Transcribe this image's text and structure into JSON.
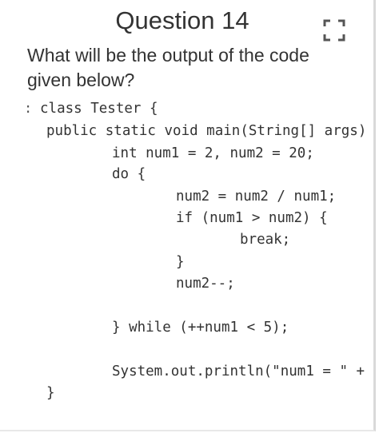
{
  "header": {
    "title": "Question 14",
    "expand_icon": "fullscreen-corners-icon"
  },
  "question": {
    "text": "What will be the output of the code given below?"
  },
  "code": {
    "marker": ":",
    "lines": [
      "class Tester {",
      "public static void main(String[] args)",
      "int num1 = 2, num2 = 20;",
      "do {",
      "num2 = num2 / num1;",
      "if (num1 > num2) {",
      "break;",
      "}",
      "num2--;",
      "} while (++num1 < 5);",
      "System.out.println(\"num1 = \" +",
      "}"
    ]
  }
}
